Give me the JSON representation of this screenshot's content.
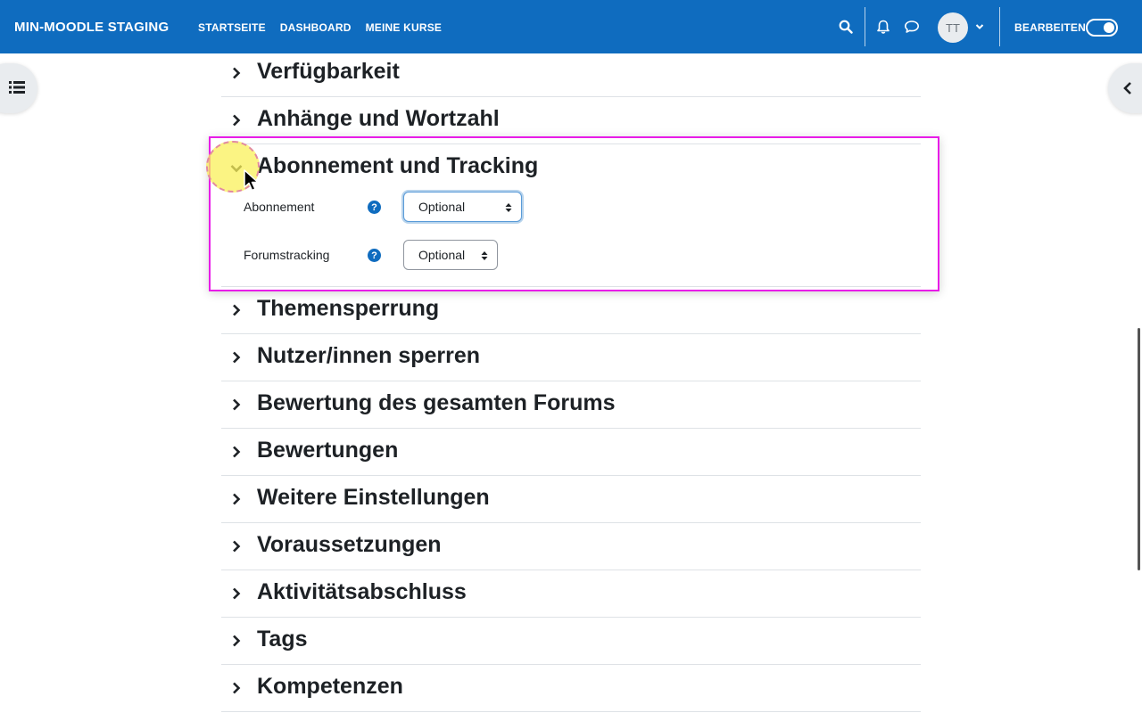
{
  "header": {
    "brand": "MIN-MOODLE STAGING",
    "nav": [
      "STARTSEITE",
      "DASHBOARD",
      "MEINE KURSE"
    ],
    "avatar_initials": "TT",
    "edit_label": "BEARBEITEN",
    "edit_mode_on": true,
    "icons": [
      "search-icon",
      "bell-icon",
      "chat-icon",
      "chevron-down-icon"
    ]
  },
  "sections_before": [
    {
      "title": "Verfügbarkeit"
    },
    {
      "title": "Anhänge und Wortzahl"
    }
  ],
  "expanded_section": {
    "title": "Abonnement und Tracking",
    "fields": [
      {
        "label": "Abonnement",
        "value": "Optional"
      },
      {
        "label": "Forumstracking",
        "value": "Optional"
      }
    ]
  },
  "sections_after": [
    {
      "title": "Themensperrung"
    },
    {
      "title": "Nutzer/innen sperren"
    },
    {
      "title": "Bewertung des gesamten Forums"
    },
    {
      "title": "Bewertungen"
    },
    {
      "title": "Weitere Einstellungen"
    },
    {
      "title": "Voraussetzungen"
    },
    {
      "title": "Aktivitätsabschluss"
    },
    {
      "title": "Tags"
    },
    {
      "title": "Kompetenzen"
    }
  ],
  "colors": {
    "header_bg": "#0f6cbf",
    "highlight_border": "#e81ce8",
    "cursor_highlight": "#faf05a"
  }
}
